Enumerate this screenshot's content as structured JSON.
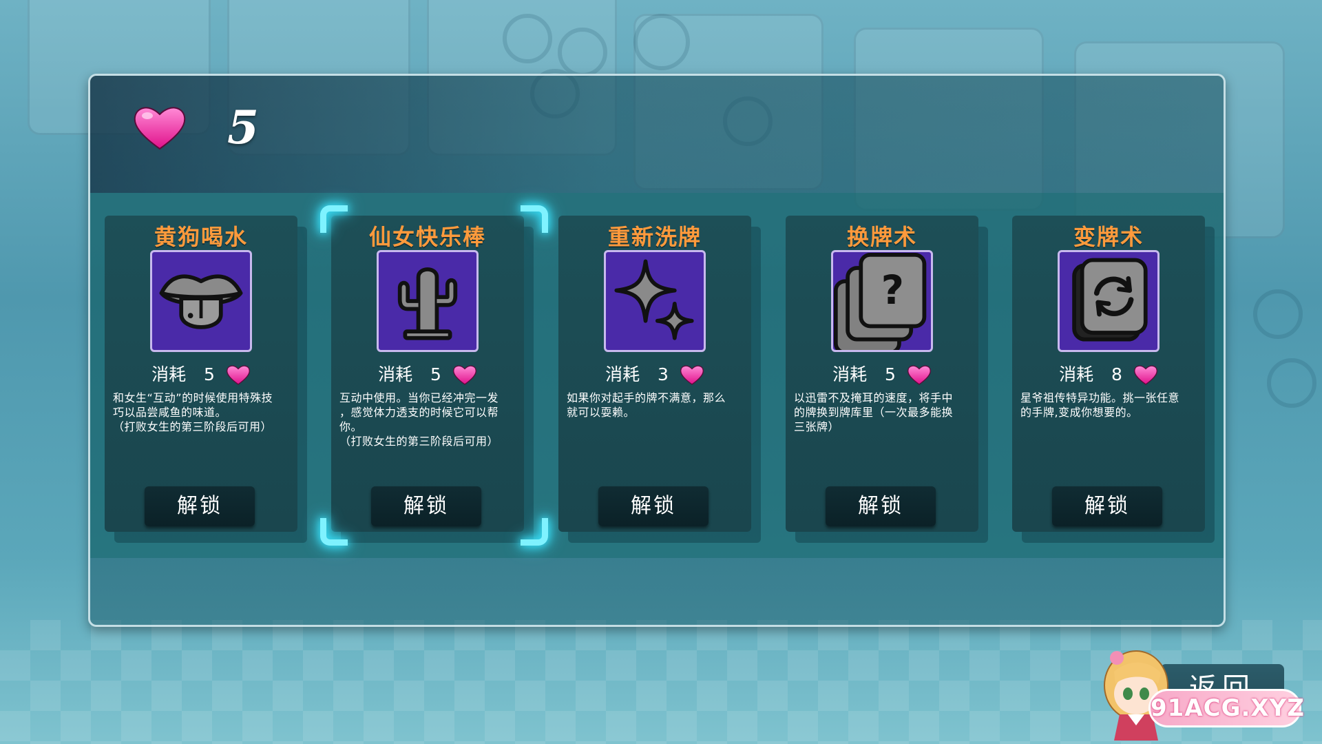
{
  "header": {
    "hearts_count": "5"
  },
  "cards": [
    {
      "title": "黄狗喝水",
      "icon": "tongue-lips-icon",
      "cost_label": "消耗",
      "cost_value": "5",
      "desc_lines": [
        "和女生“互动”的时候使用特殊技",
        "巧以品尝咸鱼的味道。",
        "（打败女生的第三阶段后可用）"
      ],
      "button": "解锁"
    },
    {
      "title": "仙女快乐棒",
      "icon": "cactus-icon",
      "cost_label": "消耗",
      "cost_value": "5",
      "desc_lines": [
        "互动中使用。当你已经冲完一发",
        "，感觉体力透支的时候它可以帮",
        "你。",
        "（打败女生的第三阶段后可用）"
      ],
      "button": "解锁",
      "selected": true
    },
    {
      "title": "重新洗牌",
      "icon": "sparkle-stars-icon",
      "cost_label": "消耗",
      "cost_value": "3",
      "desc_lines": [
        "如果你对起手的牌不满意，那么",
        "就可以耍赖。"
      ],
      "button": "解锁"
    },
    {
      "title": "换牌术",
      "icon": "question-cards-icon",
      "cost_label": "消耗",
      "cost_value": "5",
      "desc_lines": [
        "以迅雷不及掩耳的速度，将手中",
        "的牌换到牌库里（一次最多能换",
        "三张牌）"
      ],
      "button": "解锁"
    },
    {
      "title": "变牌术",
      "icon": "card-refresh-icon",
      "cost_label": "消耗",
      "cost_value": "8",
      "desc_lines": [
        "星爷祖传特异功能。挑一张任意",
        "的手牌,变成你想要的。"
      ],
      "button": "解锁"
    }
  ],
  "footer": {
    "return_label": "返回",
    "watermark": "91ACG.XYZ"
  },
  "colors": {
    "title_orange": "#ff9a3c",
    "icon_purple": "#4a2aa8",
    "heart_pink": "#ff3fb0",
    "bracket_cyan": "#7ff2ff"
  }
}
